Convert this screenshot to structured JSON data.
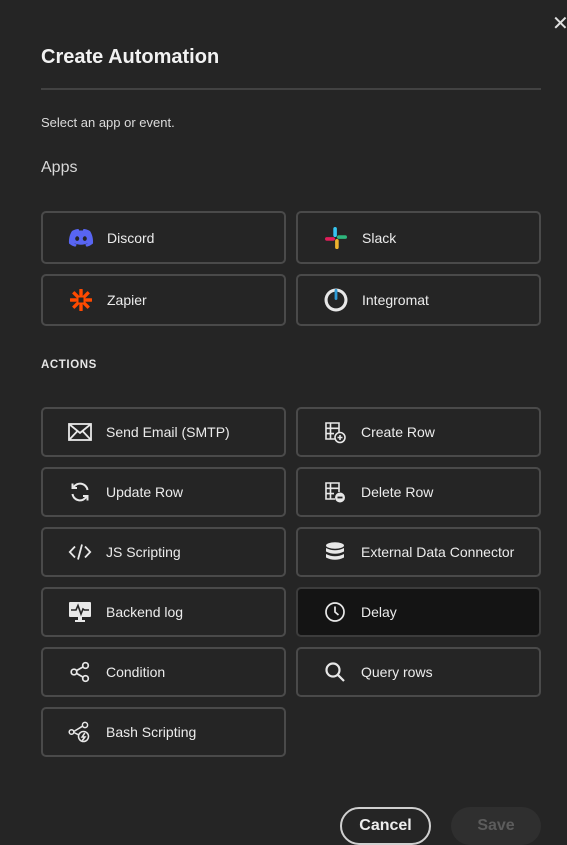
{
  "dialog": {
    "title": "Create Automation",
    "subtitle": "Select an app or event.",
    "close_glyph": "✕",
    "apps_heading": "Apps",
    "actions_heading": "ACTIONS",
    "cancel_label": "Cancel",
    "save_label": "Save",
    "selected_action": "Delay"
  },
  "apps": [
    {
      "label": "Discord",
      "icon": "discord-icon"
    },
    {
      "label": "Slack",
      "icon": "slack-icon"
    },
    {
      "label": "Zapier",
      "icon": "zapier-icon"
    },
    {
      "label": "Integromat",
      "icon": "integromat-icon"
    }
  ],
  "actions": [
    {
      "label": "Send Email (SMTP)",
      "icon": "mail-icon"
    },
    {
      "label": "Create Row",
      "icon": "table-plus-icon"
    },
    {
      "label": "Update Row",
      "icon": "refresh-icon"
    },
    {
      "label": "Delete Row",
      "icon": "table-minus-icon"
    },
    {
      "label": "JS Scripting",
      "icon": "code-icon"
    },
    {
      "label": "External Data Connector",
      "icon": "database-icon"
    },
    {
      "label": "Backend log",
      "icon": "monitor-pulse-icon"
    },
    {
      "label": "Delay",
      "icon": "clock-icon"
    },
    {
      "label": "Condition",
      "icon": "share-icon"
    },
    {
      "label": "Query rows",
      "icon": "search-icon"
    },
    {
      "label": "Bash Scripting",
      "icon": "bash-flow-icon"
    }
  ],
  "colors": {
    "background": "#252525",
    "card_border": "#4a4a4a",
    "selected_card": "#141414",
    "discord": "#5865F2",
    "zapier": "#FF4A00",
    "slack_blue": "#36C5F0",
    "slack_green": "#2EB67D",
    "slack_yellow": "#ECB22E",
    "slack_red": "#E01E5A"
  }
}
